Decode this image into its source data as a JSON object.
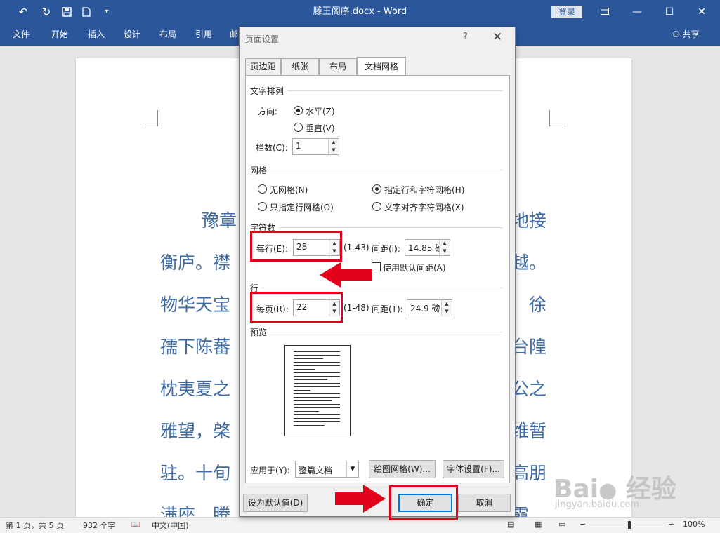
{
  "window": {
    "title": "滕王阁序.docx  -  Word",
    "login_label": "登录",
    "share_label": "共享",
    "icons": {
      "undo": "undo-icon",
      "redo": "redo-icon",
      "save": "save-icon",
      "new": "new-doc-icon",
      "customize": "customize-qat-icon"
    }
  },
  "ribbon": {
    "tabs": [
      "文件",
      "开始",
      "插入",
      "设计",
      "布局",
      "引用",
      "邮"
    ]
  },
  "document": {
    "lines": [
      {
        "left": "豫章",
        "right": "地接"
      },
      {
        "left": "衡庐。襟",
        "right": "越。"
      },
      {
        "left": "物华天宝",
        "right": "徐"
      },
      {
        "left": "孺下陈蕃",
        "right": "台隍"
      },
      {
        "left": "枕夷夏之",
        "right": "公之"
      },
      {
        "left": "雅望，棨",
        "right": "维暂"
      },
      {
        "left": "驻。十旬",
        "right": "高朋"
      },
      {
        "left": "满座。腾",
        "right": "霞"
      }
    ]
  },
  "statusbar": {
    "page": "第 1 页，共 5 页",
    "words": "932 个字",
    "language": "中文(中国)",
    "zoom": "100%",
    "zoom_minus": "−",
    "zoom_plus": "+"
  },
  "dialog": {
    "title": "页面设置",
    "help": "?",
    "close": "✕",
    "tabs": [
      "页边距",
      "纸张",
      "布局",
      "文档网格"
    ],
    "active_tab": "文档网格",
    "text_direction": {
      "section": "文字排列",
      "direction_label": "方向:",
      "horizontal": "水平(Z)",
      "vertical": "垂直(V)",
      "selected": "水平(Z)",
      "columns_label": "栏数(C):",
      "columns_value": "1"
    },
    "grid": {
      "section": "网格",
      "options": [
        "无网格(N)",
        "只指定行网格(O)",
        "指定行和字符网格(H)",
        "文字对齐字符网格(X)"
      ],
      "selected": "指定行和字符网格(H)"
    },
    "chars": {
      "section": "字符数",
      "per_line_label": "每行(E):",
      "per_line_value": "28",
      "range": "(1-43)",
      "pitch_label": "间距(I):",
      "pitch_value": "14.85 磅",
      "default_pitch_label": "使用默认间距(A)",
      "default_pitch_checked": false
    },
    "lines": {
      "section": "行",
      "per_page_label": "每页(R):",
      "per_page_value": "22",
      "range": "(1-48)",
      "pitch_label": "间距(T):",
      "pitch_value": "24.9 磅"
    },
    "preview": {
      "section": "预览"
    },
    "apply": {
      "label": "应用于(Y):",
      "value": "整篇文档",
      "draw_grid_button": "绘图网格(W)...",
      "font_settings_button": "字体设置(F)..."
    },
    "footer": {
      "set_default": "设为默认值(D)",
      "ok": "确定",
      "cancel": "取消"
    },
    "highlight_color": "#e3001b"
  },
  "watermark": {
    "brand": "Bai",
    "brand_cn": "经验",
    "url": "jingyan.baidu.com"
  },
  "colors": {
    "word_blue": "#2b579a",
    "doc_text": "#3e6aa3"
  }
}
